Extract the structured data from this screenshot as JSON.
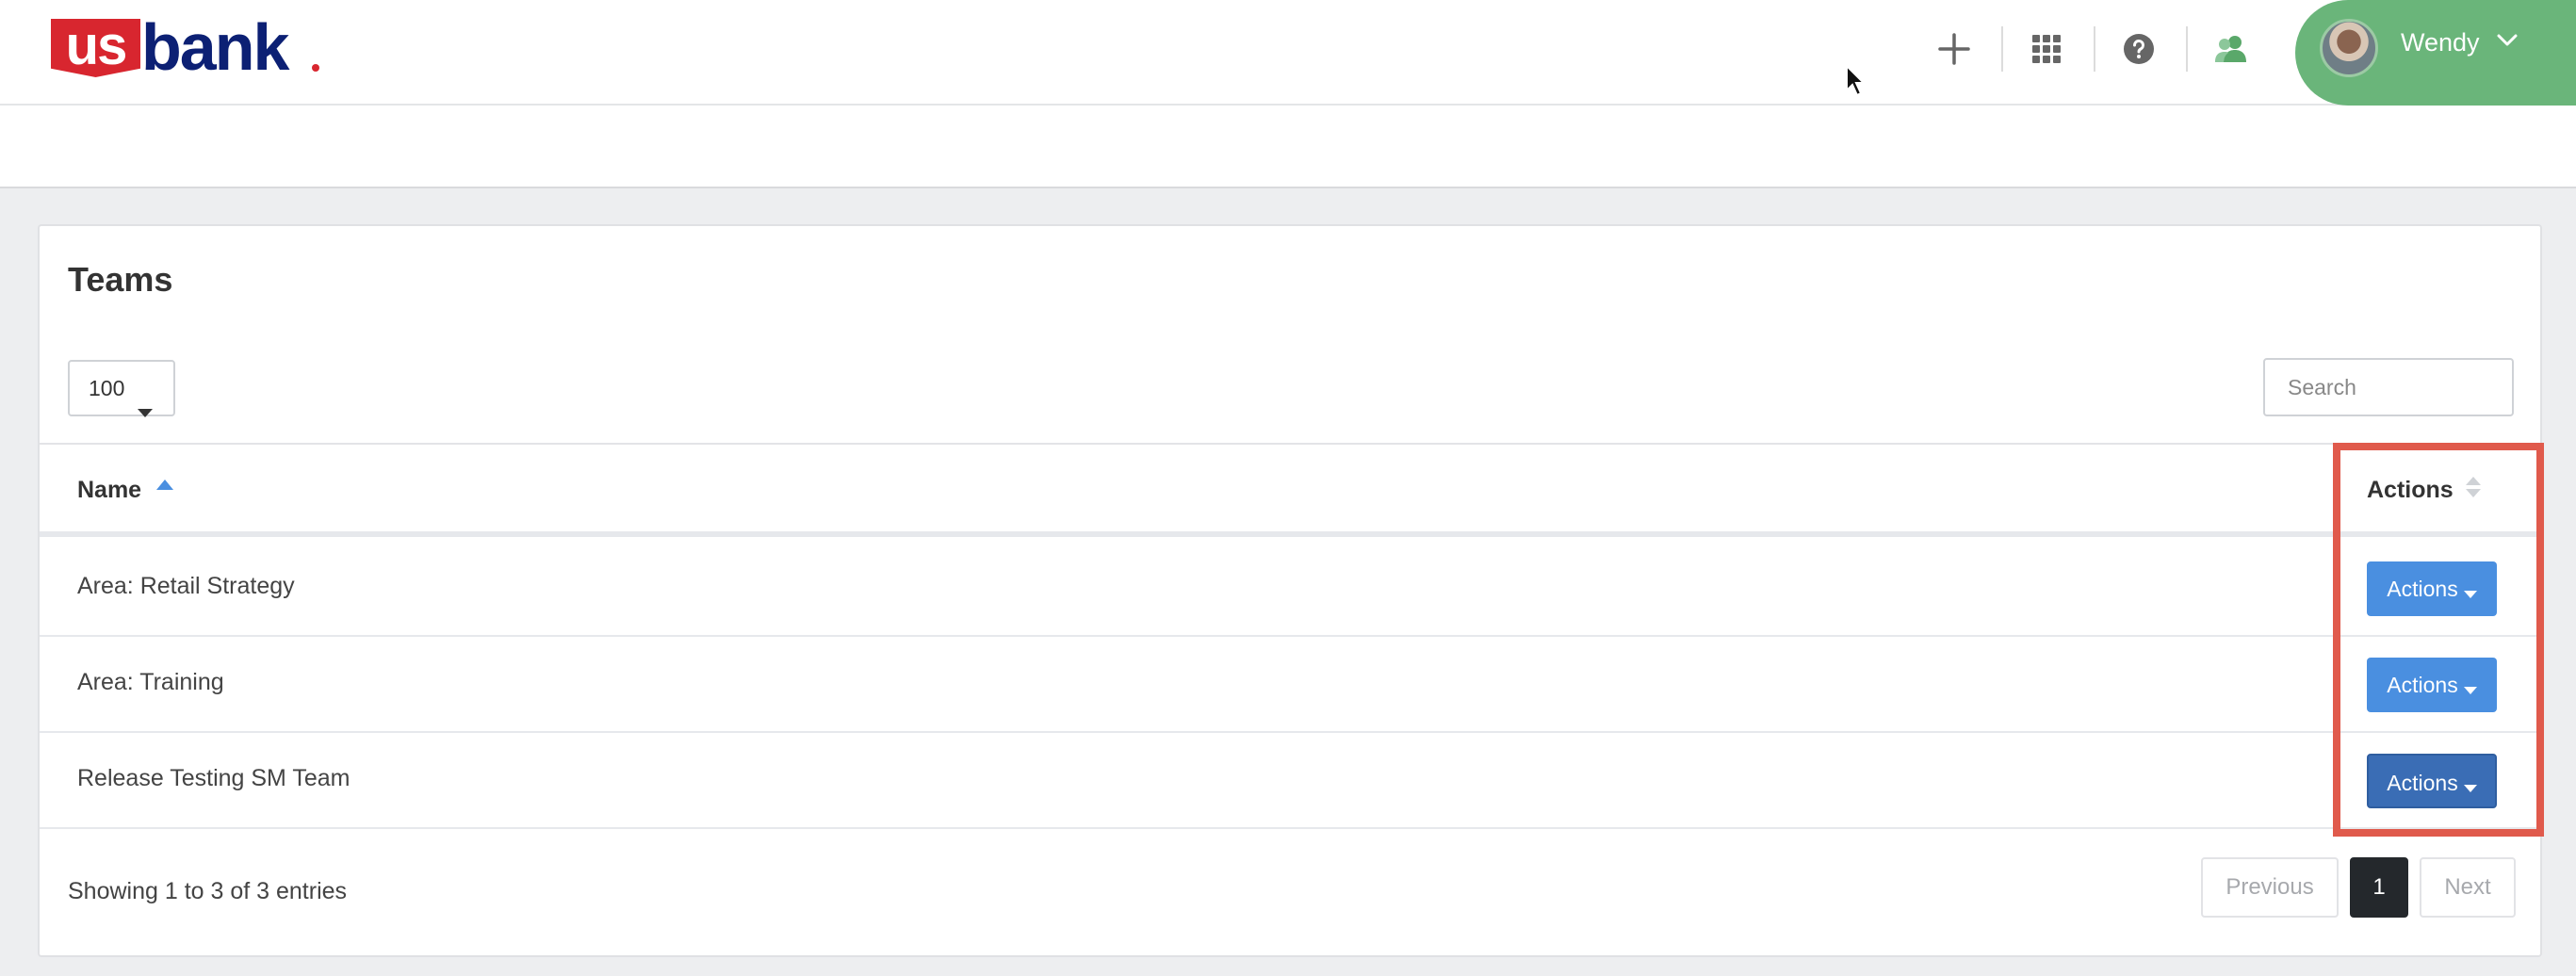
{
  "brand": {
    "logo_us": "us",
    "logo_bank": "bank",
    "primary_red": "#d8262f",
    "primary_navy": "#0c2074",
    "accent_green": "#6ab57a",
    "accent_blue": "#4a8fe0"
  },
  "header": {
    "icons": [
      "plus-icon",
      "apps-grid-icon",
      "help-icon",
      "team-icon"
    ],
    "user": {
      "name": "Wendy"
    }
  },
  "panel": {
    "title": "Teams",
    "page_size": "100",
    "search_placeholder": "Search",
    "columns": {
      "name": "Name",
      "actions": "Actions"
    },
    "rows": [
      {
        "name": "Area: Retail Strategy",
        "action_label": "Actions"
      },
      {
        "name": "Area: Training",
        "action_label": "Actions"
      },
      {
        "name": "Release Testing SM Team",
        "action_label": "Actions"
      }
    ],
    "footer": {
      "info": "Showing 1 to 3 of 3 entries",
      "prev": "Previous",
      "current_page": "1",
      "next": "Next"
    }
  }
}
